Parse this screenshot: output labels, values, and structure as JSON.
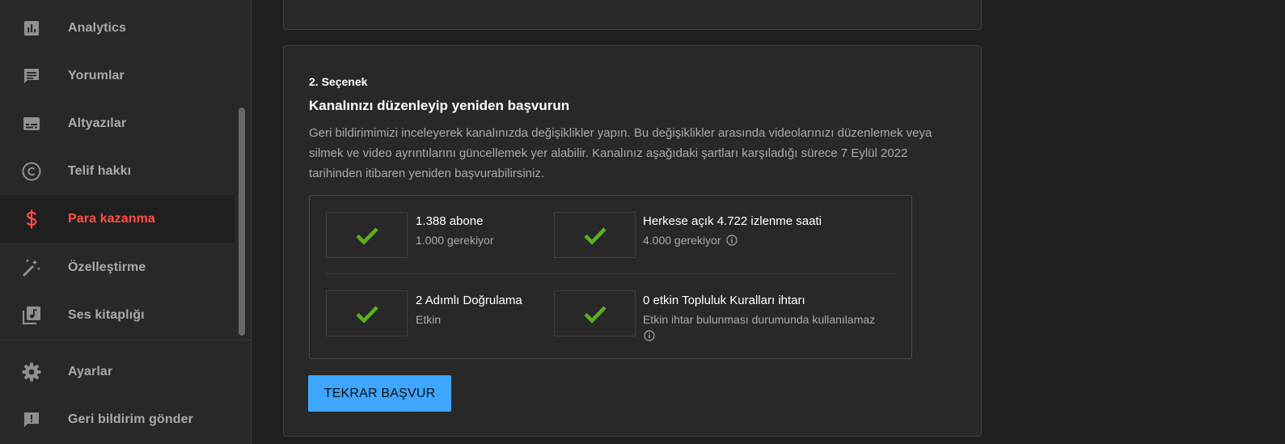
{
  "sidebar": {
    "items": [
      {
        "label": "Analytics",
        "icon": "analytics-icon"
      },
      {
        "label": "Yorumlar",
        "icon": "comments-icon"
      },
      {
        "label": "Altyazılar",
        "icon": "subtitles-icon"
      },
      {
        "label": "Telif hakkı",
        "icon": "copyright-icon"
      },
      {
        "label": "Para kazanma",
        "icon": "dollar-icon",
        "active": true
      },
      {
        "label": "Özelleştirme",
        "icon": "magic-wand-icon"
      },
      {
        "label": "Ses kitaplığı",
        "icon": "audio-library-icon"
      }
    ],
    "bottom_items": [
      {
        "label": "Ayarlar",
        "icon": "gear-icon"
      },
      {
        "label": "Geri bildirim gönder",
        "icon": "feedback-icon"
      }
    ]
  },
  "colors": {
    "accent_red": "#ff4e45",
    "check_green": "#5bb11a",
    "button_blue": "#3ea6ff"
  },
  "option": {
    "label": "2. Seçenek",
    "title": "Kanalınızı düzenleyip yeniden başvurun",
    "description": "Geri bildirimimizi inceleyerek kanalınızda değişiklikler yapın. Bu değişiklikler arasında videolarınızı düzenlemek veya silmek ve video ayrıntılarını güncellemek yer alabilir. Kanalınız aşağıdaki şartları karşıladığı sürece 7 Eylül 2022 tarihinden itibaren yeniden başvurabilirsiniz.",
    "requirements": [
      {
        "title": "1.388 abone",
        "sub": "1.000 gerekiyor",
        "met": true
      },
      {
        "title": "Herkese açık 4.722 izlenme saati",
        "sub": "4.000 gerekiyor",
        "met": true,
        "info": true
      },
      {
        "title": "2 Adımlı Doğrulama",
        "sub": "Etkin",
        "met": true
      },
      {
        "title": "0 etkin Topluluk Kuralları ihtarı",
        "sub": "Etkin ihtar bulunması durumunda kullanılamaz",
        "met": true,
        "info": true
      }
    ],
    "apply_button": "TEKRAR BAŞVUR"
  }
}
